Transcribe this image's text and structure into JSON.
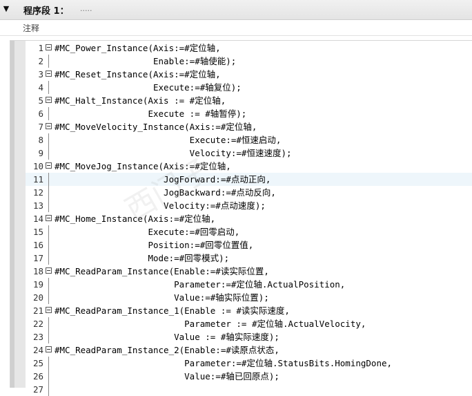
{
  "segment": {
    "toggle_icon": "▼",
    "title": "程序段 1：",
    "dots": "....."
  },
  "comment": {
    "label": "注释"
  },
  "code": {
    "highlighted_line": 11,
    "lines": [
      {
        "num": "1",
        "fold": true,
        "text": "#MC_Power_Instance(Axis:=#定位轴,"
      },
      {
        "num": "2",
        "fold": false,
        "text": "                   Enable:=#轴使能);"
      },
      {
        "num": "3",
        "fold": true,
        "text": "#MC_Reset_Instance(Axis:=#定位轴,"
      },
      {
        "num": "4",
        "fold": false,
        "text": "                   Execute:=#轴复位);"
      },
      {
        "num": "5",
        "fold": true,
        "text": "#MC_Halt_Instance(Axis := #定位轴,"
      },
      {
        "num": "6",
        "fold": false,
        "text": "                  Execute := #轴暂停);"
      },
      {
        "num": "7",
        "fold": true,
        "text": "#MC_MoveVelocity_Instance(Axis:=#定位轴,"
      },
      {
        "num": "8",
        "fold": false,
        "text": "                          Execute:=#恒速启动,"
      },
      {
        "num": "9",
        "fold": false,
        "text": "                          Velocity:=#恒速速度);"
      },
      {
        "num": "10",
        "fold": true,
        "text": "#MC_MoveJog_Instance(Axis:=#定位轴,"
      },
      {
        "num": "11",
        "fold": false,
        "text": "                     JogForward:=#点动正向,"
      },
      {
        "num": "12",
        "fold": false,
        "text": "                     JogBackward:=#点动反向,"
      },
      {
        "num": "13",
        "fold": false,
        "text": "                     Velocity:=#点动速度);"
      },
      {
        "num": "14",
        "fold": true,
        "text": "#MC_Home_Instance(Axis:=#定位轴,"
      },
      {
        "num": "15",
        "fold": false,
        "text": "                  Execute:=#回零启动,"
      },
      {
        "num": "16",
        "fold": false,
        "text": "                  Position:=#回零位置值,"
      },
      {
        "num": "17",
        "fold": false,
        "text": "                  Mode:=#回零模式);"
      },
      {
        "num": "18",
        "fold": true,
        "text": "#MC_ReadParam_Instance(Enable:=#读实际位置,"
      },
      {
        "num": "19",
        "fold": false,
        "text": "                       Parameter:=#定位轴.ActualPosition,"
      },
      {
        "num": "20",
        "fold": false,
        "text": "                       Value:=#轴实际位置);"
      },
      {
        "num": "21",
        "fold": true,
        "text": "#MC_ReadParam_Instance_1(Enable := #读实际速度,"
      },
      {
        "num": "22",
        "fold": false,
        "text": "                         Parameter := #定位轴.ActualVelocity,"
      },
      {
        "num": "23",
        "fold": false,
        "text": "                       Value := #轴实际速度);"
      },
      {
        "num": "24",
        "fold": true,
        "text": "#MC_ReadParam_Instance_2(Enable:=#读原点状态,"
      },
      {
        "num": "25",
        "fold": false,
        "text": "                         Parameter:=#定位轴.StatusBits.HomingDone,"
      },
      {
        "num": "26",
        "fold": false,
        "text": "                         Value:=#轴已回原点);"
      },
      {
        "num": "27",
        "fold": false,
        "text": ""
      }
    ]
  }
}
